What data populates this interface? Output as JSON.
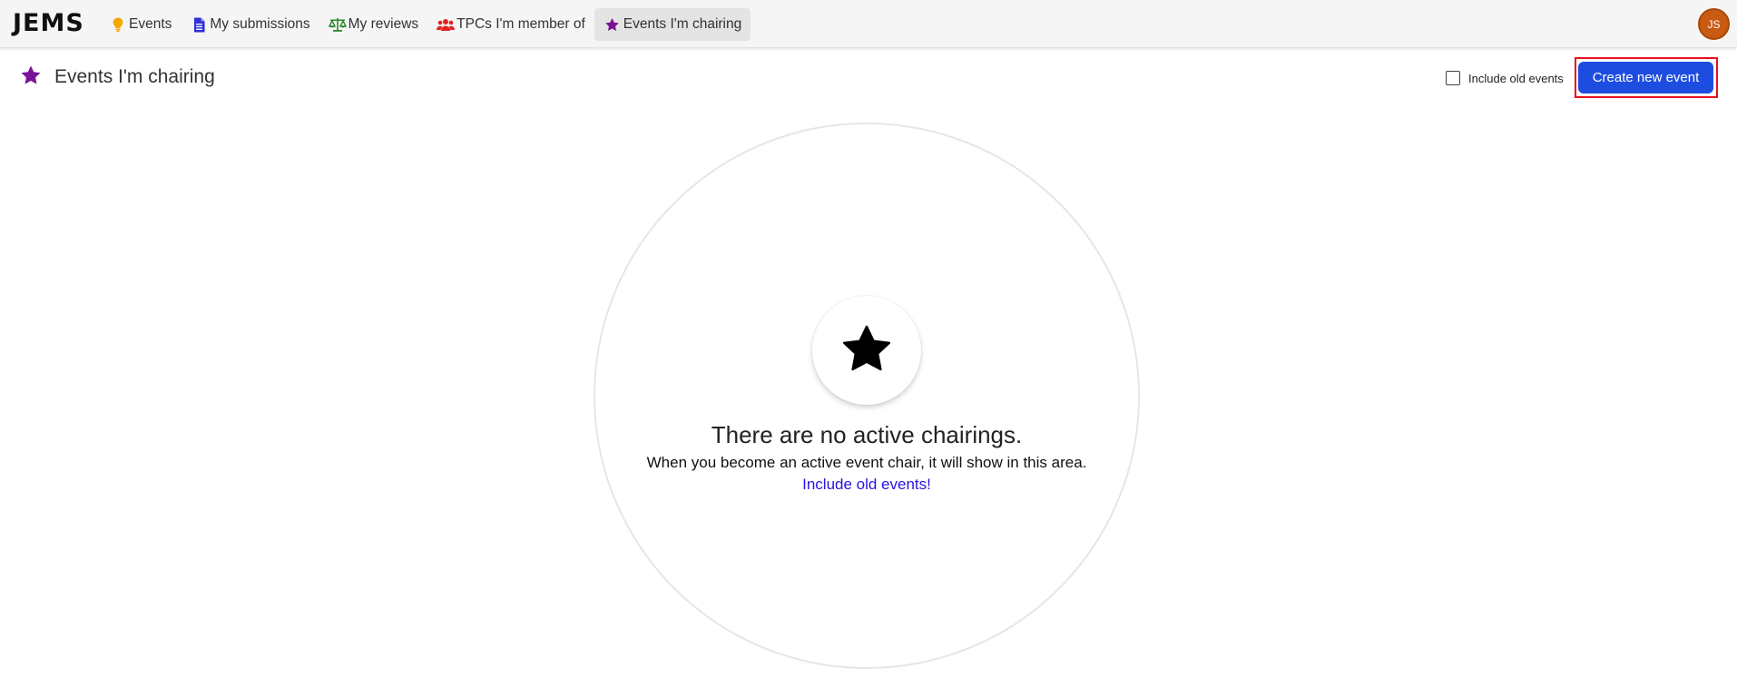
{
  "app": {
    "logo": "JEMS"
  },
  "nav": {
    "items": [
      {
        "label": "Events",
        "icon": "lightbulb-icon",
        "color": "#f5a800"
      },
      {
        "label": "My submissions",
        "icon": "document-icon",
        "color": "#2f2fd6"
      },
      {
        "label": "My reviews",
        "icon": "scale-icon",
        "color": "#2a8a2a"
      },
      {
        "label": "TPCs I'm member of",
        "icon": "users-icon",
        "color": "#e02424"
      },
      {
        "label": "Events I'm chairing",
        "icon": "star-icon",
        "color": "#7a1296",
        "active": true
      }
    ]
  },
  "user": {
    "initials": "JS",
    "avatar_color": "#c85a12"
  },
  "page": {
    "title": "Events I'm chairing",
    "title_icon": "star-icon",
    "title_icon_color": "#7a1296"
  },
  "toolbar": {
    "include_old_label": "Include old events",
    "include_old_checked": false,
    "create_label": "Create new event",
    "create_color": "#1d4de0"
  },
  "empty_state": {
    "icon": "star-icon",
    "title": "There are no active chairings.",
    "message": "When you become an active event chair, it will show in this area.",
    "link_text": "Include old events",
    "link_suffix": "!",
    "link_color": "#2a12e0"
  }
}
